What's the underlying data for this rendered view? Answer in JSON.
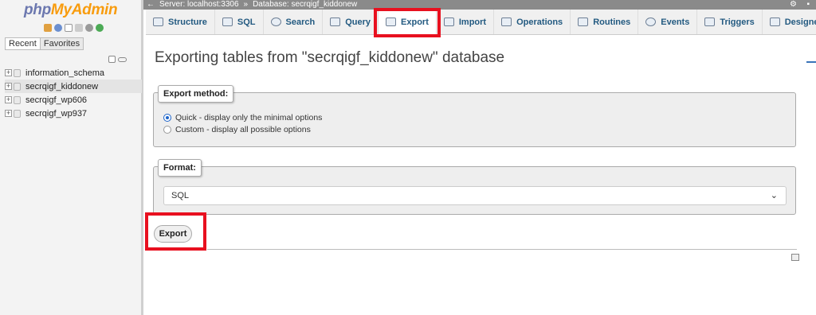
{
  "sidebar": {
    "logo_php": "php",
    "logo_myadmin": "MyAdmin",
    "recent_label": "Recent",
    "favorites_label": "Favorites",
    "databases": [
      {
        "name": "information_schema"
      },
      {
        "name": "secrqigf_kiddonew"
      },
      {
        "name": "secrqigf_wp606"
      },
      {
        "name": "secrqigf_wp937"
      }
    ]
  },
  "breadcrumb": {
    "server": "Server: localhost:3306",
    "separator": "»",
    "database": "Database: secrqigf_kiddonew"
  },
  "tabs": [
    {
      "label": "Structure",
      "icon": "structure-icon"
    },
    {
      "label": "SQL",
      "icon": "sql-icon"
    },
    {
      "label": "Search",
      "icon": "search-icon"
    },
    {
      "label": "Query",
      "icon": "query-icon"
    },
    {
      "label": "Export",
      "icon": "export-icon",
      "active": true
    },
    {
      "label": "Import",
      "icon": "import-icon"
    },
    {
      "label": "Operations",
      "icon": "operations-icon"
    },
    {
      "label": "Routines",
      "icon": "routines-icon"
    },
    {
      "label": "Events",
      "icon": "events-icon"
    },
    {
      "label": "Triggers",
      "icon": "triggers-icon"
    },
    {
      "label": "Designer",
      "icon": "designer-icon"
    }
  ],
  "main": {
    "title": "Exporting tables from \"secrqigf_kiddonew\" database",
    "export_method": {
      "legend": "Export method:",
      "options": [
        {
          "label": "Quick - display only the minimal options",
          "checked": true
        },
        {
          "label": "Custom - display all possible options",
          "checked": false
        }
      ]
    },
    "format": {
      "legend": "Format:",
      "selected": "SQL"
    },
    "export_button": "Export"
  },
  "colors": {
    "highlight": "#e8101f",
    "link": "#235a81",
    "logo_php": "#6c78af",
    "logo_myadmin": "#f89c0e"
  }
}
